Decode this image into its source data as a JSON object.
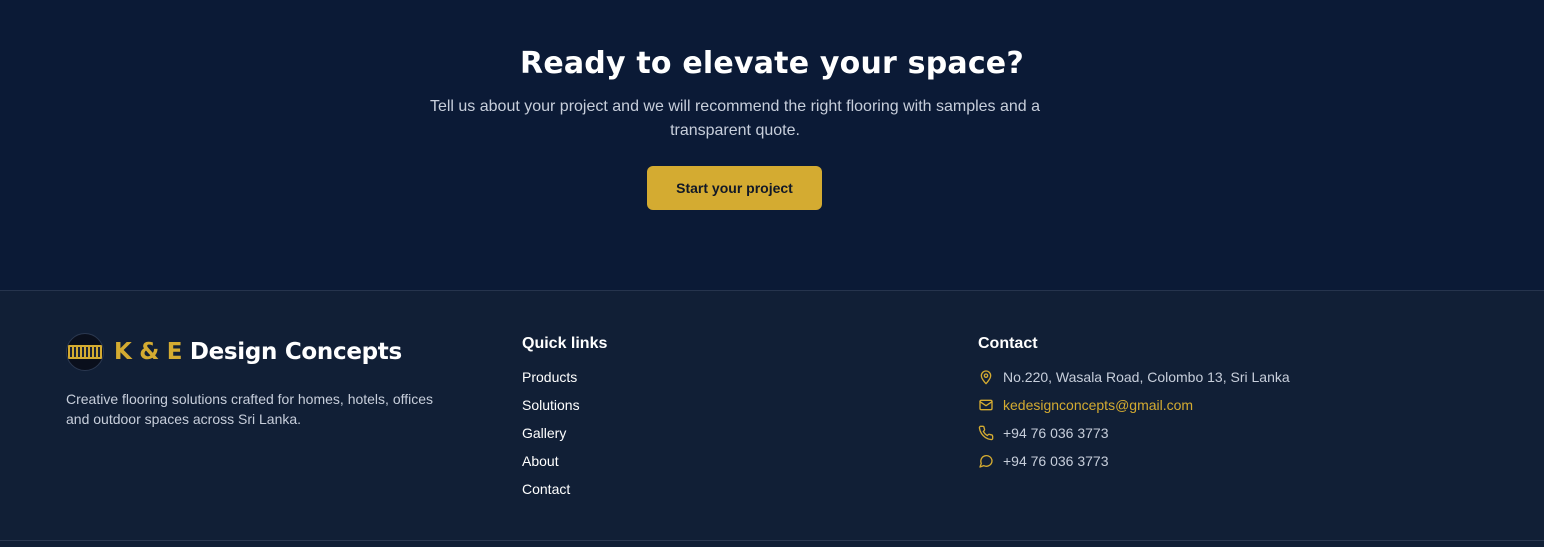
{
  "cta": {
    "title": "Ready to elevate your space?",
    "description": "Tell us about your project and we will recommend the right flooring with samples and a transparent quote.",
    "button_label": "Start your project"
  },
  "footer": {
    "brand": {
      "accent": "K & E",
      "rest": "Design Concepts",
      "description": "Creative flooring solutions crafted for homes, hotels, offices and outdoor spaces across Sri Lanka."
    },
    "quick_links": {
      "title": "Quick links",
      "items": [
        "Products",
        "Solutions",
        "Gallery",
        "About",
        "Contact"
      ]
    },
    "contact": {
      "title": "Contact",
      "address": "No.220, Wasala Road, Colombo 13, Sri Lanka",
      "email": "kedesignconcepts@gmail.com",
      "phone": "+94 76 036 3773",
      "whatsapp": "+94 76 036 3773"
    }
  },
  "colors": {
    "background": "#0b1a36",
    "footer_background": "#111f36",
    "accent": "#d4ab31",
    "muted_text": "#c7cedb"
  },
  "icons": [
    "map-pin-icon",
    "mail-icon",
    "phone-icon",
    "chat-icon"
  ]
}
